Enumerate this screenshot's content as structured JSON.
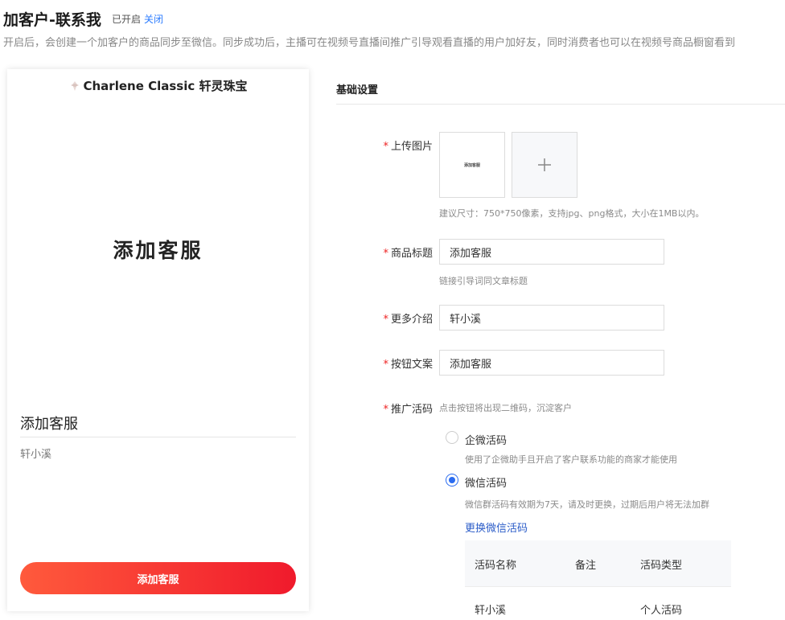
{
  "header": {
    "title": "加客户-联系我",
    "status": "已开启",
    "close_label": "关闭",
    "description": "开启后，会创建一个加客户的商品同步至微信。同步成功后，主播可在视频号直播间推广引导观看直播的用户加好友，同时消费者也可以在视频号商品橱窗看到"
  },
  "preview": {
    "shop_name": "Charlene Classic 轩灵珠宝",
    "image_text": "添加客服",
    "product_title": "添加客服",
    "intro": "轩小溪",
    "button_label": "添加客服"
  },
  "settings": {
    "section_title": "基础设置",
    "upload": {
      "label": "上传图片",
      "thumb_text": "添加客服",
      "hint": "建议尺寸：750*750像素，支持jpg、png格式，大小在1MB以内。"
    },
    "product_title": {
      "label": "商品标题",
      "value": "添加客服",
      "hint": "链接引导词同文章标题"
    },
    "more_intro": {
      "label": "更多介绍",
      "value": "轩小溪"
    },
    "button_text": {
      "label": "按钮文案",
      "value": "添加客服"
    },
    "promo_code": {
      "label": "推广活码",
      "hint": "点击按钮将出现二维码，沉淀客户",
      "options": [
        {
          "label": "企微活码",
          "desc": "使用了企微助手且开启了客户联系功能的商家才能使用",
          "checked": false
        },
        {
          "label": "微信活码",
          "desc": "微信群活码有效期为7天，请及时更换，过期后用户将无法加群",
          "checked": true
        }
      ],
      "change_link": "更换微信活码",
      "table": {
        "headers": [
          "活码名称",
          "备注",
          "活码类型"
        ],
        "rows": [
          {
            "name": "轩小溪",
            "note": "",
            "type": "个人活码"
          }
        ]
      }
    }
  },
  "colors": {
    "link": "#2b7cff",
    "accent": "#2b6cf0",
    "button_gradient_start": "#ff5a3c",
    "button_gradient_end": "#f01a2c",
    "required": "#ee2222"
  }
}
